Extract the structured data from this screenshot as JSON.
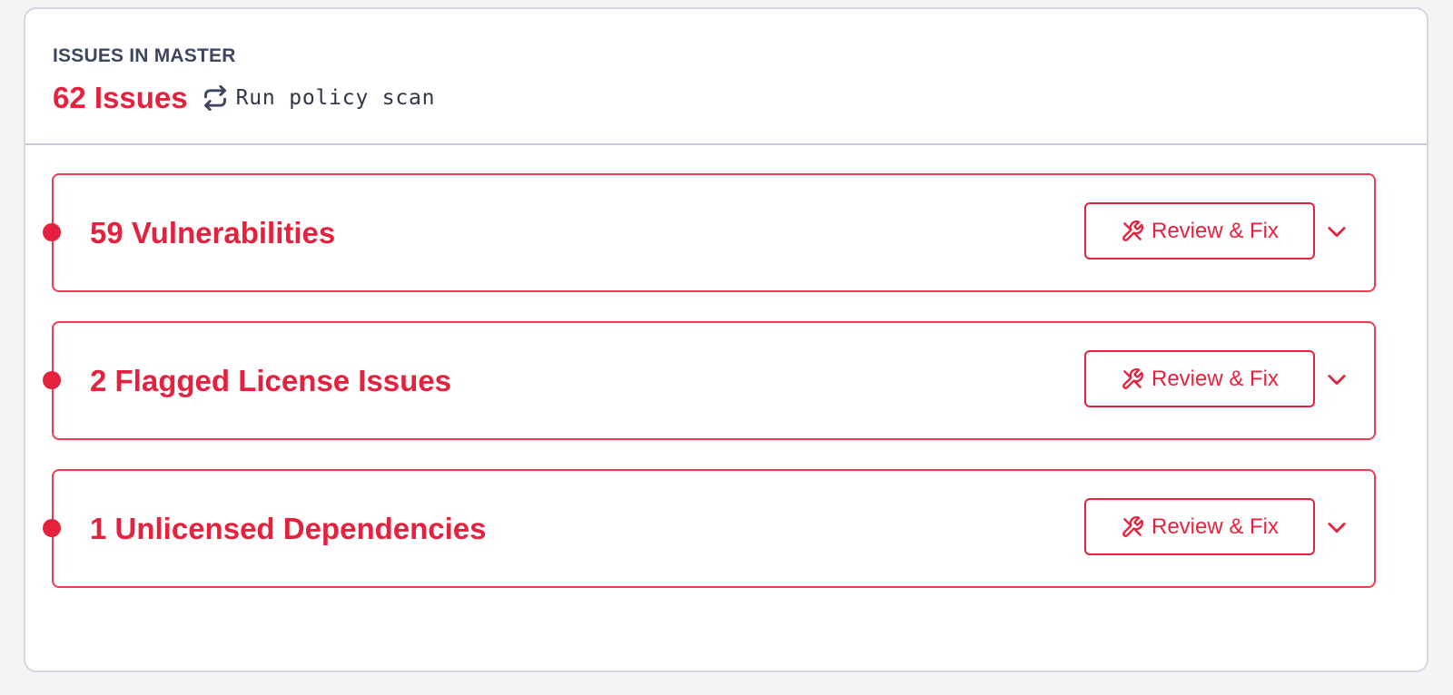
{
  "panel": {
    "eyebrow": "ISSUES IN MASTER",
    "total_issues": "62 Issues",
    "scan_action": {
      "label": "Run policy scan",
      "icon": "refresh-icon"
    }
  },
  "issue_groups": [
    {
      "title": "59 Vulnerabilities",
      "button_label": "Review & Fix",
      "button_icon": "tools-icon",
      "toggle_icon": "chevron-down-icon"
    },
    {
      "title": "2 Flagged License Issues",
      "button_label": "Review & Fix",
      "button_icon": "tools-icon",
      "toggle_icon": "chevron-down-icon"
    },
    {
      "title": "1 Unlicensed Dependencies",
      "button_label": "Review & Fix",
      "button_icon": "tools-icon",
      "toggle_icon": "chevron-down-icon"
    }
  ],
  "colors": {
    "accent": "#e5213d",
    "border_accent": "#ef3b52",
    "heading_text": "#3d4660",
    "divider": "#c3c6d4",
    "page_background": "#f4f4f5"
  }
}
